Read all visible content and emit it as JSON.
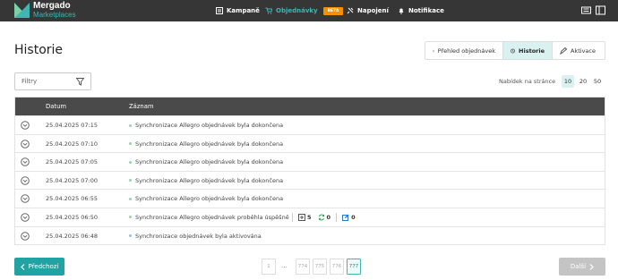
{
  "brand": {
    "line1": "Mergado",
    "line2": "Marketplaces"
  },
  "nav": {
    "campaigns": "Kampaně",
    "orders": "Objednávky",
    "beta": "BETA",
    "connections": "Napojení",
    "notifications": "Notifikace"
  },
  "page": {
    "title": "Historie"
  },
  "view_tabs": {
    "overview": "Přehled objednávek",
    "history": "Historie",
    "activation": "Aktivace"
  },
  "filter": {
    "label": "Filtry"
  },
  "per_page": {
    "label": "Nabídek na stránce",
    "options": [
      "10",
      "20",
      "50"
    ],
    "selected": "10"
  },
  "table": {
    "headers": {
      "date": "Datum",
      "record": "Záznam"
    },
    "rows": [
      {
        "date": "25.04.2025 07:15",
        "message": "Synchronizace Allegro objednávek byla dokončena",
        "status": "green"
      },
      {
        "date": "25.04.2025 07:10",
        "message": "Synchronizace Allegro objednávek byla dokončena",
        "status": "green"
      },
      {
        "date": "25.04.2025 07:05",
        "message": "Synchronizace Allegro objednávek byla dokončena",
        "status": "green"
      },
      {
        "date": "25.04.2025 07:00",
        "message": "Synchronizace Allegro objednávek byla dokončena",
        "status": "green"
      },
      {
        "date": "25.04.2025 06:55",
        "message": "Synchronizace Allegro objednávek byla dokončena",
        "status": "green"
      },
      {
        "date": "25.04.2025 06:50",
        "message": "Synchronizace Allegro objednávek proběhla úspěšně",
        "status": "green",
        "stats": {
          "new": "5",
          "synced": "0",
          "edited": "0"
        }
      },
      {
        "date": "25.04.2025 06:48",
        "message": "Synchronizace objednávek byla aktivována",
        "status": "blue"
      }
    ]
  },
  "pagination": {
    "prev": "Předchozí",
    "next": "Další",
    "pages": [
      "1",
      "...",
      "774",
      "775",
      "776",
      "777"
    ],
    "current": "777"
  },
  "colors": {
    "accent": "#1fa3a3",
    "topbar": "#363636",
    "beta": "#f39200",
    "table_header": "#4a4a4a"
  }
}
